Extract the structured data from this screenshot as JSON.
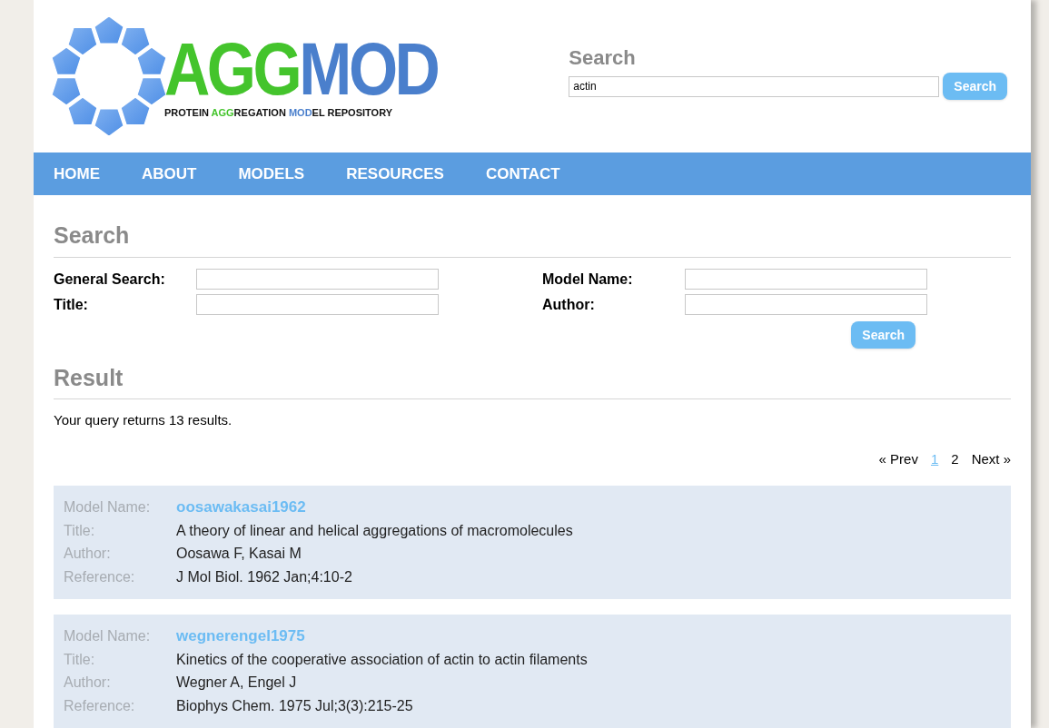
{
  "logo": {
    "wordmark": [
      {
        "text": "AGG",
        "color": "#44c42c"
      },
      {
        "text": "MOD",
        "color": "#4a7fcc"
      }
    ],
    "tagline": [
      {
        "text": "PROTEIN ",
        "color": "#111111"
      },
      {
        "text": "AGG",
        "color": "#44c42c"
      },
      {
        "text": "REGATION ",
        "color": "#111111"
      },
      {
        "text": "MOD",
        "color": "#4a7fcc"
      },
      {
        "text": "EL REPOSITORY",
        "color": "#111111"
      }
    ]
  },
  "header_search": {
    "title": "Search",
    "value": "actin",
    "button": "Search"
  },
  "nav": [
    "HOME",
    "ABOUT",
    "MODELS",
    "RESOURCES",
    "CONTACT"
  ],
  "search": {
    "title": "Search",
    "fields": [
      {
        "label": "General Search:"
      },
      {
        "label": "Model Name:"
      },
      {
        "label": "Title:"
      },
      {
        "label": "Author:"
      }
    ],
    "button": "Search"
  },
  "result": {
    "title": "Result",
    "summary": "Your query returns 13 results.",
    "pagination": [
      {
        "label": "« Prev",
        "selected": false
      },
      {
        "label": "1",
        "selected": true
      },
      {
        "label": "2",
        "selected": false
      },
      {
        "label": "Next »",
        "selected": false
      }
    ],
    "entries": [
      {
        "model_name_label": "Model Name:",
        "model_name": "oosawakasai1962",
        "rows": [
          {
            "label": "Title:",
            "value": "A theory of linear and helical aggregations of macromolecules"
          },
          {
            "label": "Author:",
            "value": "Oosawa F, Kasai M"
          },
          {
            "label": "Reference:",
            "value": "J Mol Biol. 1962 Jan;4:10-2"
          }
        ]
      },
      {
        "model_name_label": "Model Name:",
        "model_name": "wegnerengel1975",
        "rows": [
          {
            "label": "Title:",
            "value": "Kinetics of the cooperative association of actin to actin filaments"
          },
          {
            "label": "Author:",
            "value": "Wegner A, Engel J"
          },
          {
            "label": "Reference:",
            "value": "Biophys Chem. 1975 Jul;3(3):215-25"
          }
        ]
      }
    ]
  }
}
